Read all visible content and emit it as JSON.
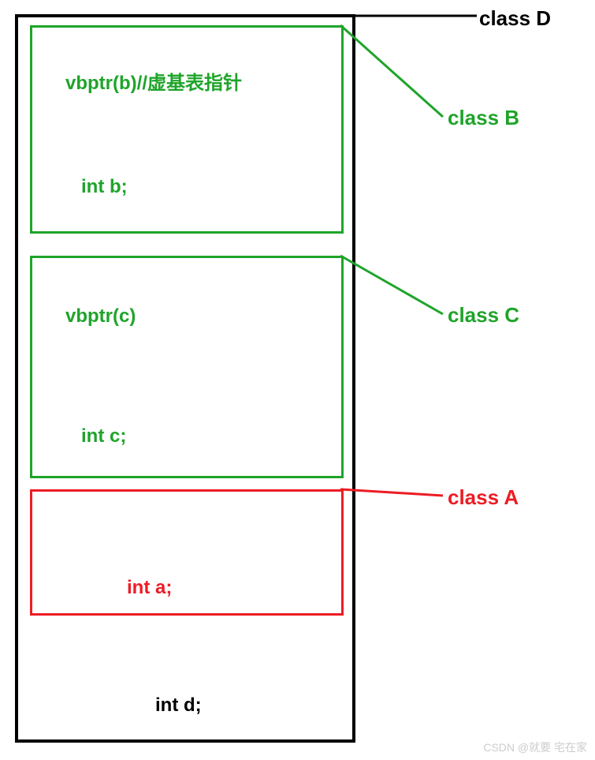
{
  "labels": {
    "classD": "class D",
    "classB": "class B",
    "classC": "class C",
    "classA": "class A"
  },
  "boxB": {
    "line1": "vbptr(b)//虚基表指针",
    "line2": "int b;"
  },
  "boxC": {
    "line1": "vbptr(c)",
    "line2": "int c;"
  },
  "boxA": {
    "line1": "int a;"
  },
  "outer": {
    "intd": "int d;"
  },
  "watermark": "CSDN @就要 宅在家"
}
